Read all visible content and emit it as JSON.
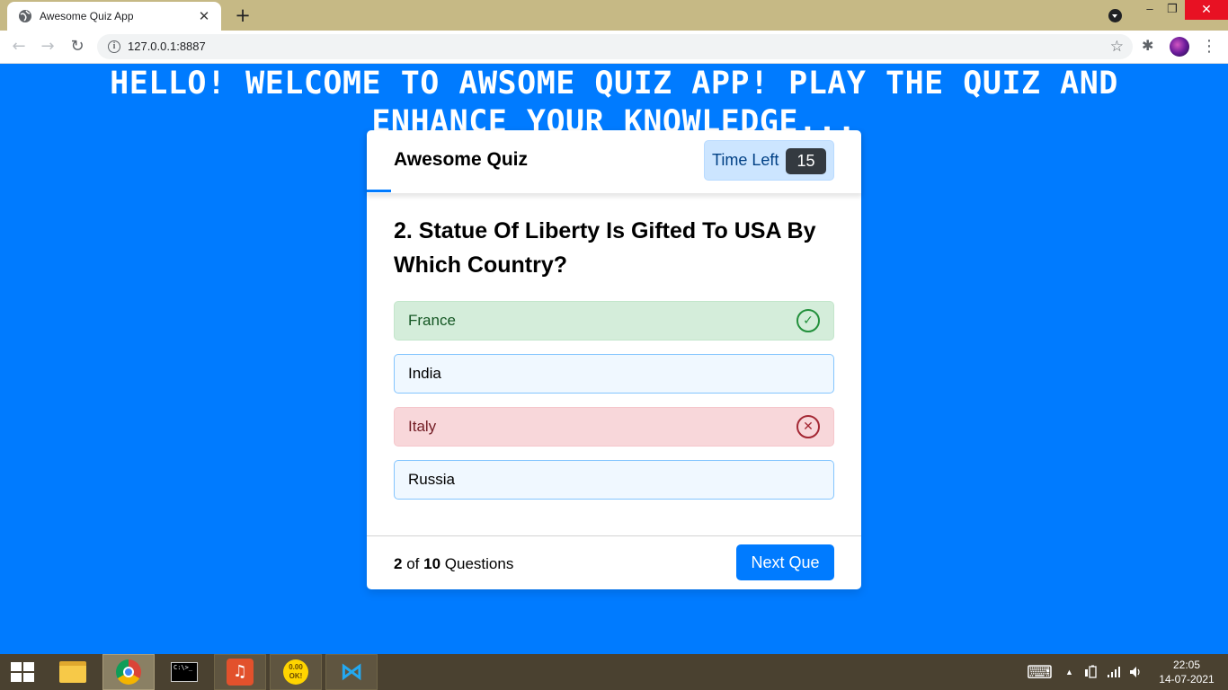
{
  "browser": {
    "tab_title": "Awesome Quiz App",
    "tab_close": "✕",
    "new_tab": "+",
    "url": "127.0.0.1:8887",
    "minimize": "–",
    "restore": "❐",
    "close": "✕",
    "back": "←",
    "forward": "→",
    "reload": "↻",
    "info": "i",
    "star": "☆",
    "extensions": "✱",
    "menu": "⋮"
  },
  "page": {
    "banner": "HELLO! WELCOME TO AWSOME QUIZ APP! PLAY THE QUIZ AND ENHANCE YOUR KNOWLEDGE..."
  },
  "quiz": {
    "title": "Awesome Quiz",
    "time_label": "Time Left",
    "time_seconds": "15",
    "question": "2. Statue Of Liberty Is Gifted To USA By Which Country?",
    "options": [
      {
        "text": "France",
        "state": "correct",
        "icon": "✓"
      },
      {
        "text": "India",
        "state": "normal"
      },
      {
        "text": "Italy",
        "state": "incorrect",
        "icon": "✕"
      },
      {
        "text": "Russia",
        "state": "normal"
      }
    ],
    "footer": {
      "current": "2",
      "of": "of",
      "total": "10",
      "questions": "Questions",
      "next_button": "Next Que"
    }
  },
  "taskbar": {
    "cmd_text": "C:\\>_",
    "music_icon": "♫",
    "ok_text": "0.00 OK!",
    "vscode_icon": "⋈",
    "keyboard_icon": "⌨",
    "up_arrow": "▲",
    "time": "22:05",
    "date": "14-07-2021"
  },
  "colors": {
    "page_bg": "#007bff",
    "correct_bg": "#d4edda",
    "incorrect_bg": "#f8d7da",
    "option_bg": "#f0f8ff"
  }
}
